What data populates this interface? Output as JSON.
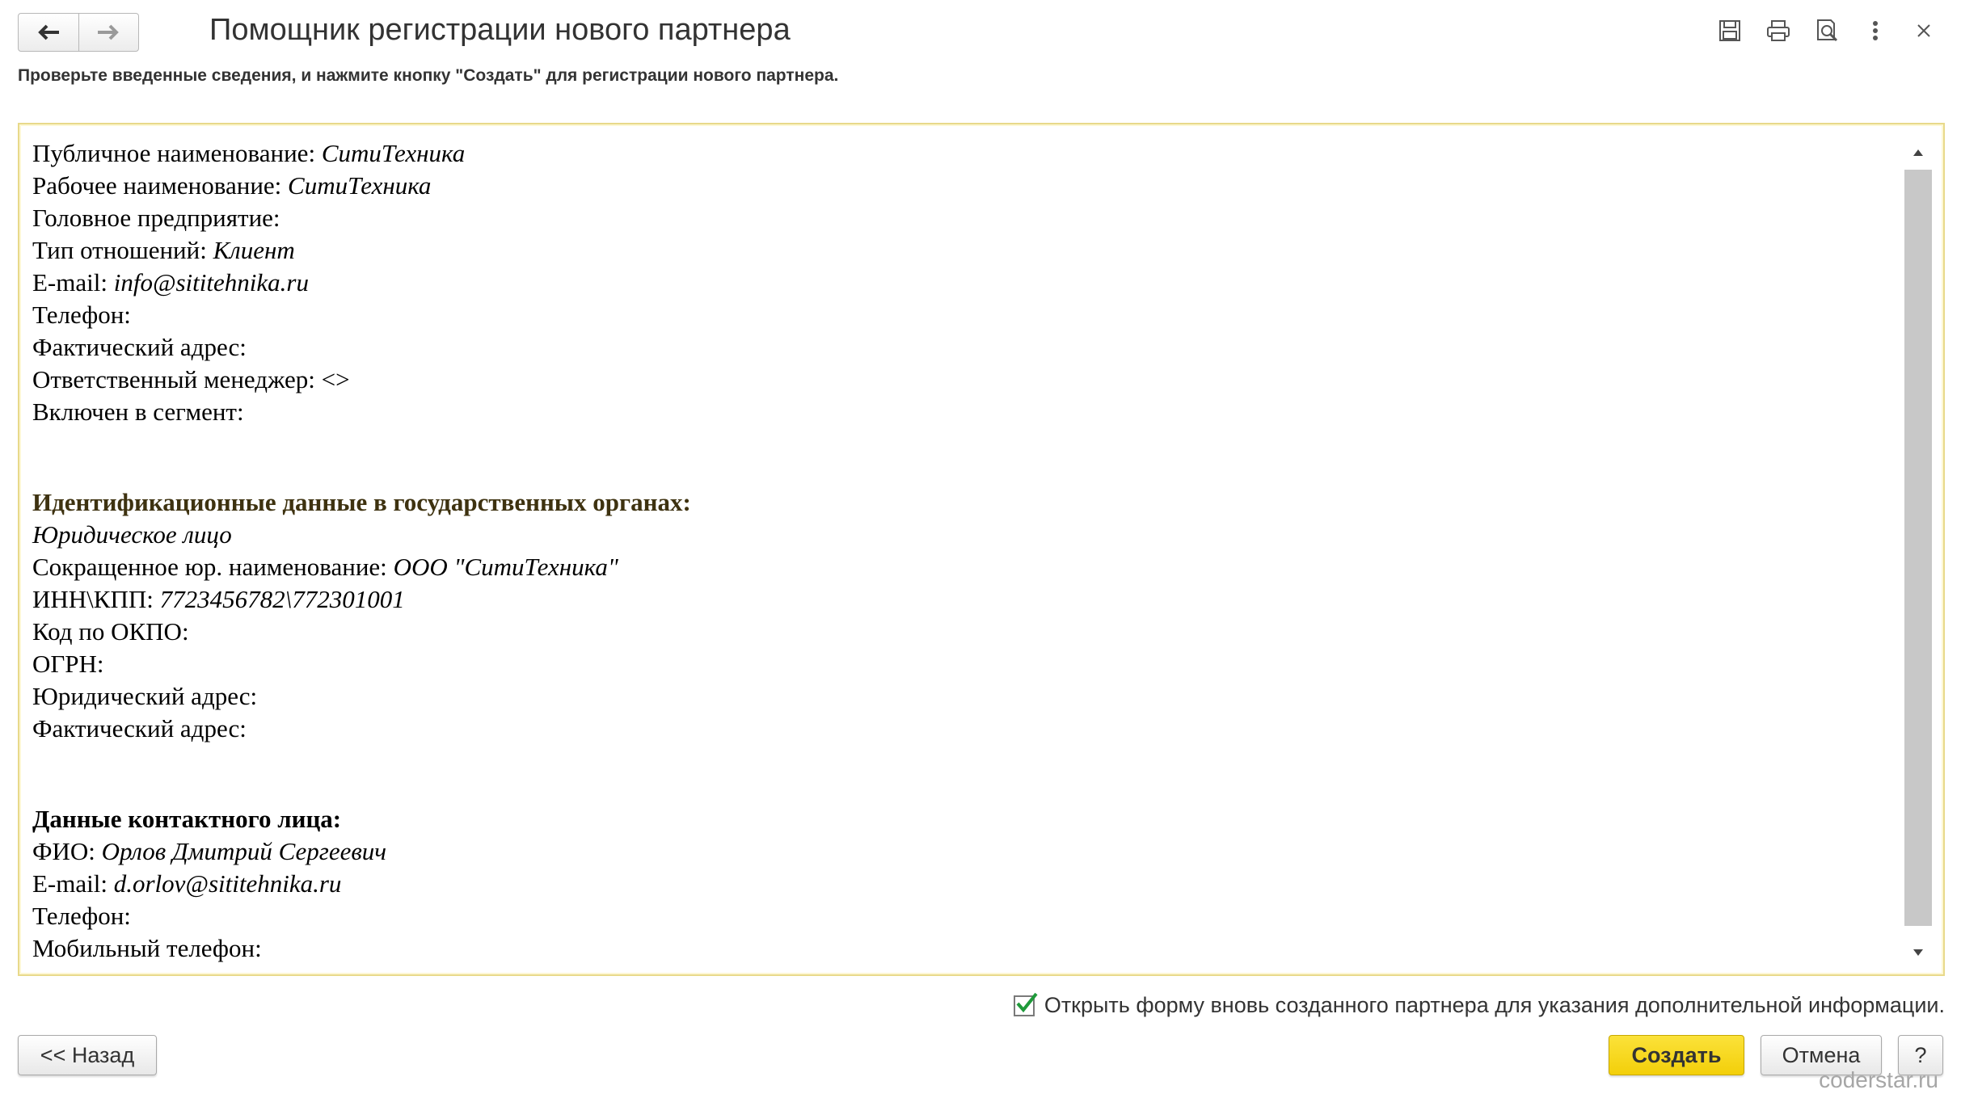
{
  "window": {
    "title": "Помощник регистрации нового партнера",
    "hint": "Проверьте введенные сведения, и нажмите кнопку \"Создать\"  для регистрации нового партнера."
  },
  "toolbar": {
    "icons": [
      "save-icon",
      "print-icon",
      "print-preview-icon",
      "more-icon",
      "close-icon"
    ]
  },
  "document": {
    "general": [
      {
        "label": "Публичное наименование: ",
        "value": "СитиТехника"
      },
      {
        "label": "Рабочее наименование: ",
        "value": "СитиТехника"
      },
      {
        "label": "Головное предприятие:",
        "value": ""
      },
      {
        "label": "Тип отношений: ",
        "value": "Клиент"
      },
      {
        "label": "E-mail: ",
        "value": "info@sititehnika.ru"
      },
      {
        "label": "Телефон:",
        "value": ""
      },
      {
        "label": "Фактический адрес:",
        "value": ""
      },
      {
        "label": "Ответственный менеджер: <>",
        "value": ""
      },
      {
        "label": "Включен в сегмент:",
        "value": ""
      }
    ],
    "gov_heading": "Идентификационные данные в государственных органах:",
    "gov_type": "Юридическое лицо",
    "gov": [
      {
        "label": "Сокращенное юр. наименование: ",
        "value": "ООО \"СитиТехника\""
      },
      {
        "label": "ИНН\\КПП: ",
        "value": "7723456782\\772301001"
      },
      {
        "label": "Код по ОКПО:",
        "value": ""
      },
      {
        "label": "ОГРН:",
        "value": ""
      },
      {
        "label": "Юридический адрес:",
        "value": ""
      },
      {
        "label": "Фактический адрес:",
        "value": ""
      }
    ],
    "contact_heading": "Данные контактного лица:",
    "contact": [
      {
        "label": "ФИО: ",
        "value": "Орлов Дмитрий Сергеевич"
      },
      {
        "label": "E-mail: ",
        "value": "d.orlov@sititehnika.ru"
      },
      {
        "label": "Телефон:",
        "value": ""
      },
      {
        "label": "Мобильный телефон:",
        "value": ""
      }
    ]
  },
  "footer": {
    "checkbox_label": "Открыть форму вновь созданного партнера для указания дополнительной информации.",
    "checkbox_checked": true,
    "back_label": "<< Назад",
    "create_label": "Создать",
    "cancel_label": "Отмена",
    "help_label": "?"
  },
  "watermark": "coderstar.ru",
  "colors": {
    "accent_yellow": "#f5d312",
    "check_green": "#1f9a3a"
  }
}
